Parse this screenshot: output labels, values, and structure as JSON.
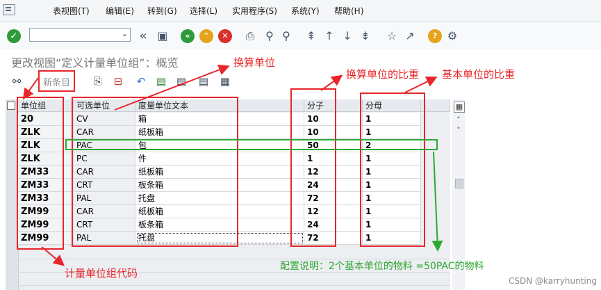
{
  "menu": {
    "items": [
      {
        "label": "表视图(T)"
      },
      {
        "label": "编辑(E)"
      },
      {
        "label": "转到(G)"
      },
      {
        "label": "选择(L)"
      },
      {
        "label": "实用程序(S)"
      },
      {
        "label": "系统(Y)"
      },
      {
        "label": "帮助(H)"
      }
    ]
  },
  "toolbar": {
    "command_field_value": ""
  },
  "page": {
    "title": "更改视图“定义计量单位组”：概览"
  },
  "actions": {
    "new_entries": "新条目"
  },
  "table": {
    "headers": [
      "单位组",
      "可选单位",
      "度量单位文本",
      "分子",
      "分母"
    ],
    "rows": [
      {
        "group": "20",
        "unit": "CV",
        "text": "箱",
        "numerator": "10",
        "denominator": "1"
      },
      {
        "group": "ZLK",
        "unit": "CAR",
        "text": "纸板箱",
        "numerator": "10",
        "denominator": "1"
      },
      {
        "group": "ZLK",
        "unit": "PAC",
        "text": "包",
        "numerator": "50",
        "denominator": "2"
      },
      {
        "group": "ZLK",
        "unit": "PC",
        "text": "件",
        "numerator": "1",
        "denominator": "1"
      },
      {
        "group": "ZM33",
        "unit": "CAR",
        "text": "纸板箱",
        "numerator": "12",
        "denominator": "1"
      },
      {
        "group": "ZM33",
        "unit": "CRT",
        "text": "板条箱",
        "numerator": "24",
        "denominator": "1"
      },
      {
        "group": "ZM33",
        "unit": "PAL",
        "text": "托盘",
        "numerator": "72",
        "denominator": "1"
      },
      {
        "group": "ZM99",
        "unit": "CAR",
        "text": "纸板箱",
        "numerator": "12",
        "denominator": "1"
      },
      {
        "group": "ZM99",
        "unit": "CRT",
        "text": "板条箱",
        "numerator": "24",
        "denominator": "1"
      },
      {
        "group": "ZM99",
        "unit": "PAL",
        "text": "托盘",
        "numerator": "72",
        "denominator": "1"
      }
    ]
  },
  "annotations": {
    "conversion_unit": "换算单位",
    "conversion_weight": "换算单位的比重",
    "base_weight": "基本单位的比重",
    "group_code": "计量单位组代码",
    "config_note": "配置说明：2个基本单位的物料 =50PAC的物料",
    "colors": {
      "red": "#e8262b",
      "green": "#2fa832"
    }
  },
  "watermark": "CSDN @karryhunting"
}
